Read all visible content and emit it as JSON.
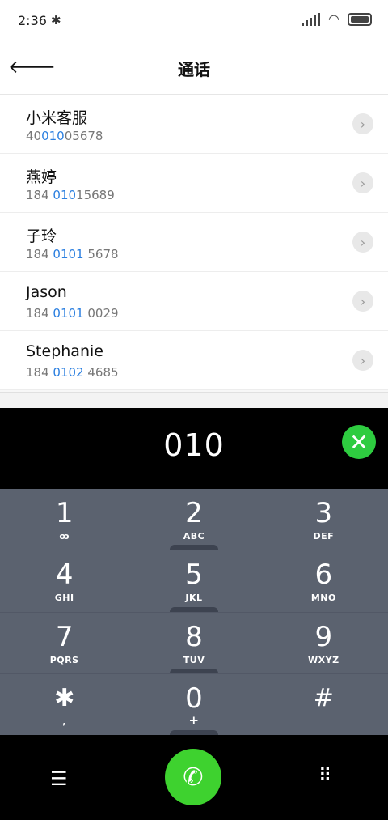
{
  "status": {
    "time": "2:36",
    "bluetooth_icon": "bluetooth-icon"
  },
  "header": {
    "title": "通话"
  },
  "contacts": [
    {
      "name": "小米客服",
      "number_pre": "40",
      "number_hl": "010",
      "number_post": "05678"
    },
    {
      "name": "燕婷",
      "number_pre": "184 ",
      "number_hl": "010",
      "number_post": "15689"
    },
    {
      "name": "子玲",
      "number_pre": "184 ",
      "number_hl": "0101",
      "number_post": " 5678"
    },
    {
      "name": "Jason",
      "number_pre": "184 ",
      "number_hl": "0101",
      "number_post": " 0029"
    },
    {
      "name": "Stephanie",
      "number_pre": "184 ",
      "number_hl": "0102",
      "number_post": " 4685"
    }
  ],
  "dial": {
    "digits": "010"
  },
  "keys": [
    {
      "big": "1",
      "small": "ꝏ"
    },
    {
      "big": "2",
      "small": "ABC"
    },
    {
      "big": "3",
      "small": "DEF"
    },
    {
      "big": "4",
      "small": "GHI"
    },
    {
      "big": "5",
      "small": "JKL"
    },
    {
      "big": "6",
      "small": "MNO"
    },
    {
      "big": "7",
      "small": "PQRS"
    },
    {
      "big": "8",
      "small": "TUV"
    },
    {
      "big": "9",
      "small": "WXYZ"
    },
    {
      "big": "✱",
      "small": ","
    },
    {
      "big": "0",
      "small": "+"
    },
    {
      "big": "#",
      "small": ""
    }
  ],
  "colors": {
    "accent": "#2b7fe0",
    "call": "#3ed22f",
    "clear": "#2ecc40",
    "keypad": "#5b626f"
  }
}
